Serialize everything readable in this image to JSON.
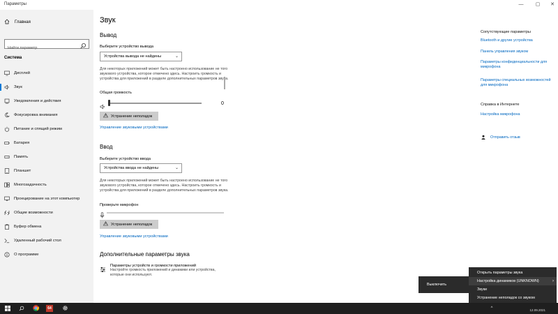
{
  "window": {
    "title": "Параметры",
    "controls": [
      "—",
      "▢",
      "✕"
    ]
  },
  "sidebar": {
    "home_label": "Главная",
    "search_placeholder": "Найти параметр",
    "section_label": "Система",
    "items": [
      {
        "label": "Дисплей",
        "icon": "display-icon"
      },
      {
        "label": "Звук",
        "icon": "speaker-icon",
        "active": true
      },
      {
        "label": "Уведомления и действия",
        "icon": "notification-icon"
      },
      {
        "label": "Фокусировка внимания",
        "icon": "moon-icon"
      },
      {
        "label": "Питание и спящий режим",
        "icon": "power-icon"
      },
      {
        "label": "Батарея",
        "icon": "battery-icon"
      },
      {
        "label": "Память",
        "icon": "storage-icon"
      },
      {
        "label": "Планшет",
        "icon": "tablet-icon"
      },
      {
        "label": "Многозадачность",
        "icon": "multitask-icon"
      },
      {
        "label": "Проецирование на этот компьютер",
        "icon": "project-icon"
      },
      {
        "label": "Общие возможности",
        "icon": "shared-icon"
      },
      {
        "label": "Буфер обмена",
        "icon": "clipboard-icon"
      },
      {
        "label": "Удаленный рабочий стол",
        "icon": "remote-icon"
      },
      {
        "label": "О программе",
        "icon": "info-icon"
      }
    ]
  },
  "main": {
    "title": "Звук",
    "output": {
      "heading": "Вывод",
      "select_label": "Выберите устройство вывода",
      "select_value": "Устройства вывода не найдены",
      "description": "Для некоторых приложений может быть настроено использование не того звукового устройства, которое отмечено здесь. Настроить громкость и устройства для приложений в разделе дополнительных параметров звука.",
      "volume_label": "Общая громкость",
      "volume_value": "0",
      "volume_level": 0,
      "troubleshoot_label": "Устранение неполадок",
      "manage_link": "Управление звуковыми устройствами"
    },
    "input": {
      "heading": "Ввод",
      "select_label": "Выберите устройство ввода",
      "select_value": "Устройства ввода не найдены",
      "description": "Для некоторых приложений может быть настроено использование не того звукового устройства, которое отмечено здесь. Настроить громкость и устройства для приложений в разделе дополнительных параметров звука.",
      "mic_label": "Проверьте микрофон",
      "troubleshoot_label": "Устранение неполадок",
      "manage_link": "Управление звуковыми устройствами"
    },
    "advanced": {
      "heading": "Дополнительные параметры звука",
      "item_title": "Параметры устройств и громкости приложений",
      "item_desc": "Настройте громкость приложений и динамики или устройства, которые они используют."
    }
  },
  "related": {
    "heading": "Сопутствующие параметры",
    "links": [
      "Bluetooth и другие устройства",
      "Панель управления звуком",
      "Параметры конфиденциальности для микрофона",
      "Параметры специальных возможностей для микрофона"
    ],
    "help_heading": "Справка в Интернете",
    "help_links": [
      "Настройка микрофона"
    ],
    "feedback": "Отправить отзыв"
  },
  "context_menu": {
    "items": [
      "Открыть параметры звука",
      "Настройка динамиков (UNKNOWN)",
      "Звуки",
      "Устранение неполадок со звуком"
    ],
    "submenu_item": "Выключить"
  },
  "taskbar": {
    "badge": "64",
    "clock_date": "12.09.2021"
  }
}
